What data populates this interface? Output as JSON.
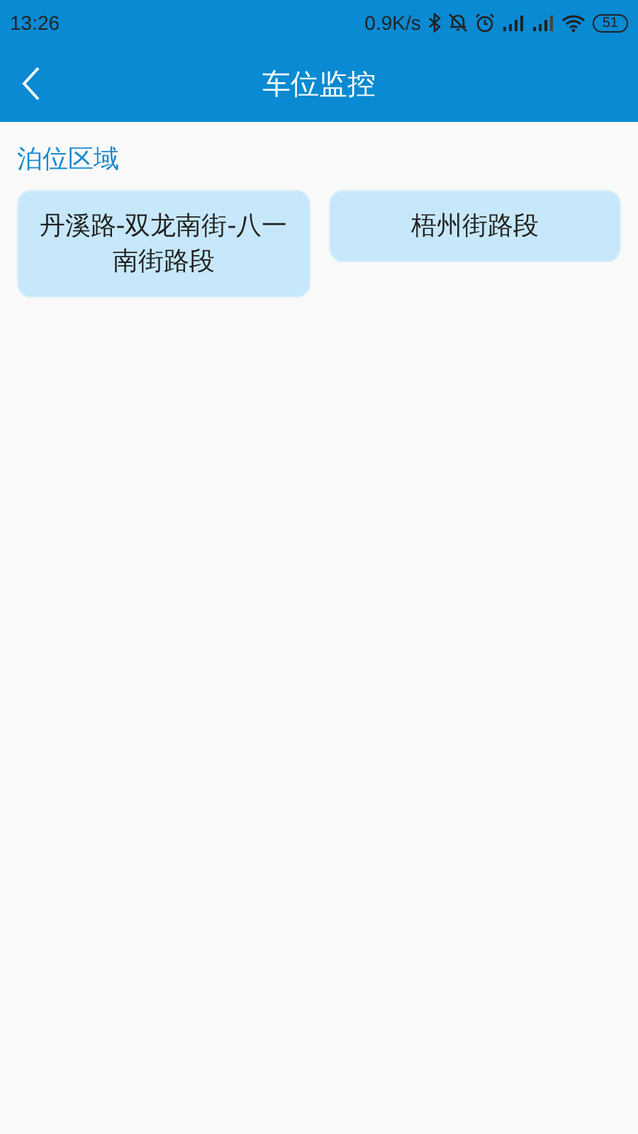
{
  "status_bar": {
    "time": "13:26",
    "speed": "0.9K/s",
    "battery": "51"
  },
  "header": {
    "title": "车位监控"
  },
  "section": {
    "title": "泊位区域"
  },
  "areas": [
    {
      "name": "丹溪路-双龙南街-八一南街路段"
    },
    {
      "name": "梧州街路段"
    }
  ]
}
